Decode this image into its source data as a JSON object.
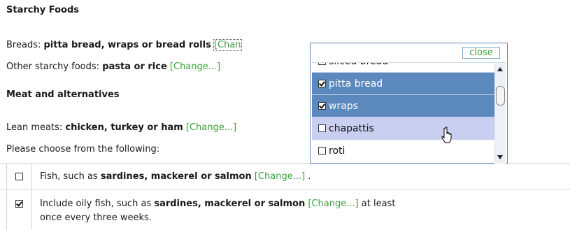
{
  "sections": {
    "starchy_heading": "Starchy Foods",
    "meat_heading": "Meat and alternatives"
  },
  "breads": {
    "label": "Breads: ",
    "value": "pitta bread, wraps or bread rolls",
    "change_fragment": "[Chan"
  },
  "other_starchy": {
    "label": "Other starchy foods: ",
    "value": "pasta or rice",
    "change": "[Change...]"
  },
  "lean_meats": {
    "label": "Lean meats: ",
    "value": "chicken, turkey or ham",
    "change": "[Change...]"
  },
  "choose_text": "Please choose from the following:",
  "choices": [
    {
      "checked": false,
      "prefix": "Fish, such as ",
      "bold": "sardines, mackerel or salmon",
      "change": "[Change...]",
      "suffix": " ."
    },
    {
      "checked": true,
      "prefix": "Include oily fish, such as ",
      "bold": "sardines, mackerel or salmon",
      "change": "[Change...]",
      "suffix": " at least",
      "line2": "once every three weeks."
    }
  ],
  "popup": {
    "close_label": "close",
    "options": [
      {
        "label": "sliced bread",
        "checked": false,
        "state": "partial"
      },
      {
        "label": "pitta bread",
        "checked": true,
        "state": "selected"
      },
      {
        "label": "wraps",
        "checked": true,
        "state": "selected"
      },
      {
        "label": "chapattis",
        "checked": false,
        "state": "hover"
      },
      {
        "label": "roti",
        "checked": false,
        "state": "normal"
      }
    ]
  },
  "colors": {
    "link": "#3aa13a",
    "selected_bg": "#5b88bd",
    "hover_bg": "#c9cff0",
    "popup_border": "#5b86b8"
  }
}
